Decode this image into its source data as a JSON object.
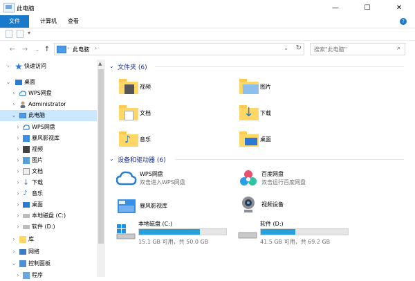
{
  "window": {
    "title": "此电脑",
    "minimize": "—",
    "maximize": "☐",
    "close": "✕"
  },
  "ribbon": {
    "tabs": [
      "文件",
      "计算机",
      "查看"
    ],
    "help": "?"
  },
  "navbar": {
    "back": "←",
    "forward": "→",
    "recent": "⌄",
    "up": "↑",
    "breadcrumb": "此电脑",
    "sep": "›",
    "search_placeholder": "搜索\"此电脑\""
  },
  "sidebar": {
    "items": [
      {
        "label": "快速访问",
        "icon": "star-icon"
      },
      {
        "label": "桌面",
        "icon": "desktop-icon"
      },
      {
        "label": "WPS网盘",
        "icon": "cloud-icon"
      },
      {
        "label": "Administrator",
        "icon": "user-icon"
      },
      {
        "label": "此电脑",
        "icon": "computer-icon"
      },
      {
        "label": "WPS网盘",
        "icon": "cloud-icon"
      },
      {
        "label": "暴风影视库",
        "icon": "video-library-icon"
      },
      {
        "label": "视频",
        "icon": "video-folder-icon"
      },
      {
        "label": "图片",
        "icon": "pictures-folder-icon"
      },
      {
        "label": "文档",
        "icon": "documents-folder-icon"
      },
      {
        "label": "下载",
        "icon": "downloads-folder-icon"
      },
      {
        "label": "音乐",
        "icon": "music-folder-icon"
      },
      {
        "label": "桌面",
        "icon": "desktop-icon"
      },
      {
        "label": "本地磁盘 (C:)",
        "icon": "drive-icon"
      },
      {
        "label": "软件 (D:)",
        "icon": "drive-icon"
      },
      {
        "label": "库",
        "icon": "library-icon"
      },
      {
        "label": "网络",
        "icon": "network-icon"
      },
      {
        "label": "控制面板",
        "icon": "control-panel-icon"
      },
      {
        "label": "程序",
        "icon": "programs-icon"
      }
    ]
  },
  "content": {
    "folders_section": "文件夹 (6)",
    "folders": [
      "视频",
      "图片",
      "文档",
      "下载",
      "音乐",
      "桌面"
    ],
    "devices_section": "设备和驱动器 (6)",
    "devices": [
      {
        "name": "WPS网盘",
        "sub": "双击进入WPS网盘"
      },
      {
        "name": "百度网盘",
        "sub": "双击运行百度网盘"
      },
      {
        "name": "暴风影视库",
        "sub": ""
      },
      {
        "name": "视频设备",
        "sub": ""
      }
    ],
    "drives": [
      {
        "name": "本地磁盘 (C:)",
        "info": "15.1 GB 可用，共 50.0 GB",
        "used_fraction": 0.698
      },
      {
        "name": "软件 (D:)",
        "info": "41.5 GB 可用，共 69.2 GB",
        "used_fraction": 0.4
      }
    ]
  },
  "colors": {
    "accent": "#1979ca",
    "selected": "#cce8ff",
    "drive_bar": "#26a0da",
    "section_title": "#1e3287"
  }
}
